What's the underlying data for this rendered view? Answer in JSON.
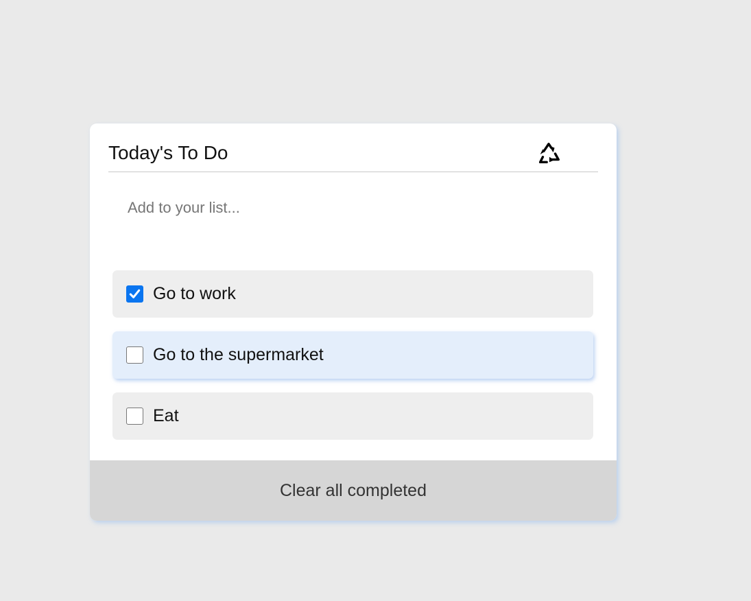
{
  "header": {
    "title": "Today's To Do",
    "recycle_icon": "recycle-icon"
  },
  "add_input": {
    "placeholder": "Add to your list...",
    "value": ""
  },
  "todos": [
    {
      "label": "Go to work",
      "checked": true,
      "hovered": false
    },
    {
      "label": "Go to the supermarket",
      "checked": false,
      "hovered": true
    },
    {
      "label": "Eat",
      "checked": false,
      "hovered": false
    }
  ],
  "footer": {
    "clear_label": "Clear all completed"
  },
  "colors": {
    "background": "#eaeaea",
    "card": "#ffffff",
    "item": "#eeeeee",
    "item_hover": "#e4eefb",
    "checkbox_accent": "#0a75f0",
    "footer": "#d6d6d6"
  }
}
